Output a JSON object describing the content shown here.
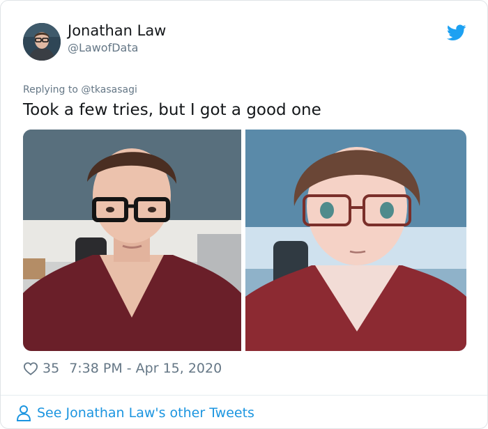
{
  "author": {
    "name": "Jonathan Law",
    "handle": "@LawofData"
  },
  "tweet": {
    "replying_prefix": "Replying to ",
    "replying_to": "@tkasasagi",
    "text": "Took a few tries, but I got a good one"
  },
  "media": {
    "left_photo": "photo of man with glasses",
    "right_photo": "anime-style drawing of man with glasses"
  },
  "meta": {
    "likes": "35",
    "timestamp": "7:38 PM - Apr 15, 2020"
  },
  "footer": {
    "link_text": "See Jonathan Law's other Tweets"
  },
  "colors": {
    "twitter_blue": "#1da1f2",
    "link_blue": "#1b95e0",
    "text_dark": "#14171a",
    "text_gray": "#657786"
  },
  "icons": [
    "twitter-bird-icon",
    "heart-icon",
    "person-icon"
  ]
}
